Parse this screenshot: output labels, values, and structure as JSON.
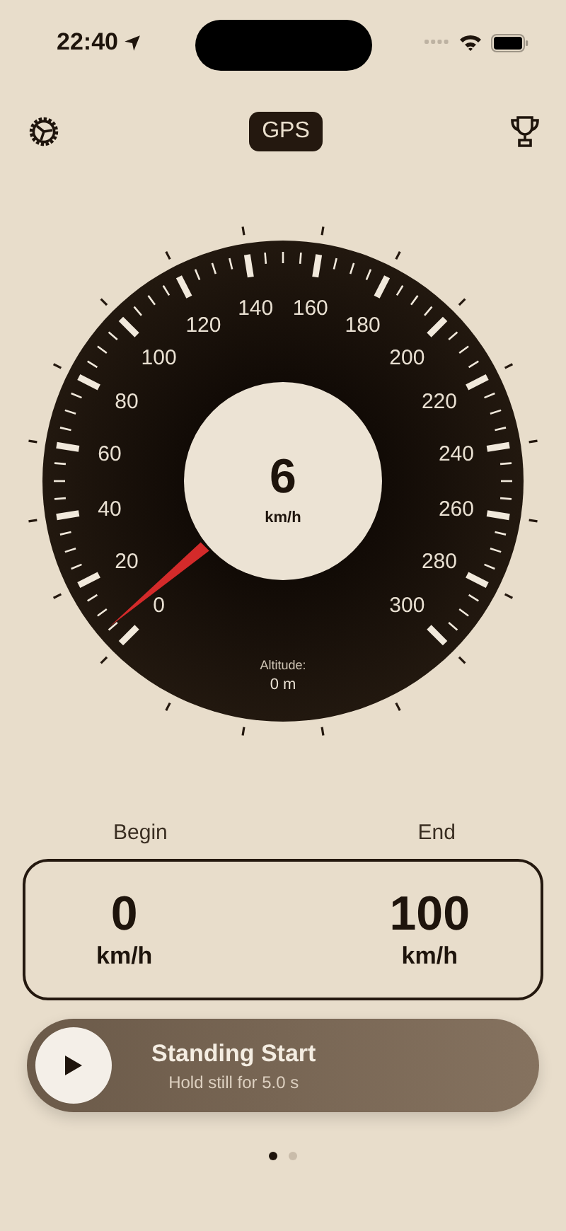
{
  "status_bar": {
    "time": "22:40"
  },
  "toolbar": {
    "mode": "GPS"
  },
  "gauge": {
    "speed": "6",
    "unit": "km/h",
    "altitude_label": "Altitude:",
    "altitude": "0 m",
    "scale_labels": [
      "0",
      "20",
      "40",
      "60",
      "80",
      "100",
      "120",
      "140",
      "160",
      "180",
      "200",
      "220",
      "240",
      "260",
      "280",
      "300"
    ]
  },
  "range": {
    "begin_label": "Begin",
    "end_label": "End",
    "begin_value": "0",
    "begin_unit": "km/h",
    "end_value": "100",
    "end_unit": "km/h"
  },
  "start_button": {
    "title": "Standing Start",
    "subtitle": "Hold still for 5.0 s"
  },
  "pages": [
    {
      "selected": true
    },
    {
      "selected": false
    }
  ]
}
